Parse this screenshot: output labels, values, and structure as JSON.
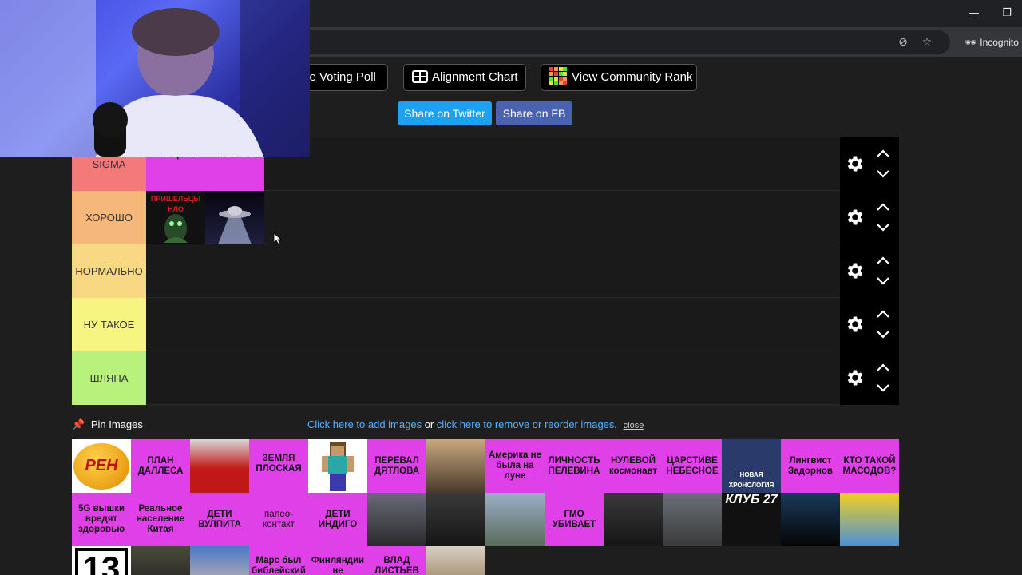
{
  "browser": {
    "minimize_icon": "minimize-icon",
    "restore_icon": "restore-icon",
    "incognito_label": "Incognito"
  },
  "toolbar": {
    "voting_poll": "ve Voting Poll",
    "alignment_chart": "Alignment Chart",
    "community_rank": "View Community Rank",
    "share_twitter": "Share on Twitter",
    "share_fb": "Share on FB"
  },
  "colors": {
    "tier_sigma": "#f47a7a",
    "tier_good": "#f6b87a",
    "tier_normal": "#f8d882",
    "tier_meh": "#f6f582",
    "tier_hat": "#b8f27c",
    "pink_tile": "#e040e8",
    "twitter": "#1da1f2",
    "fb": "#4a63b0"
  },
  "tiers": [
    {
      "label": "SIGMA",
      "items": [
        "ДВОИНИКИ ЕЛЬЦИНА",
        "ДВОИНИКИ ПУТИНА"
      ]
    },
    {
      "label": "ХОРОШО",
      "items": [
        "ПРИШЕЛЬЦЫ НЛО",
        ""
      ]
    },
    {
      "label": "НОРМАЛЬНО",
      "items": []
    },
    {
      "label": "НУ ТАКОЕ",
      "items": []
    },
    {
      "label": "ШЛЯПА",
      "items": []
    }
  ],
  "pin": {
    "title": "Pin Images",
    "add_link": "Click here to add images",
    "or": " or ",
    "remove_link": "click here to remove or reorder images",
    "dot": ".",
    "close": "close"
  },
  "pool": {
    "r1": [
      "РЕН",
      "ПЛАН ДАЛЛЕСА",
      "",
      "ЗЕМЛЯ ПЛОСКАЯ",
      "",
      "ПЕРЕВАЛ ДЯТЛОВА",
      "",
      "Америка не была на луне",
      "ЛИЧНОСТЬ ПЕЛЕВИНА",
      "НУЛЕВОЙ космонавт",
      "ЦАРСТИВЕ НЕБЕСНОЕ",
      "НОВАЯ ХРОНОЛОГИЯ",
      "Лингвист Задорнов",
      "КТО ТАКОЙ МАСОДОВ?"
    ],
    "r2": [
      "5G вышки вредят здоровью",
      "Реальное население Китая",
      "ДЕТИ ВУЛПИТА",
      "палео-контакт",
      "ДЕТИ ИНДИГО",
      "",
      "",
      "",
      "ГМО УБИВАЕТ",
      "",
      "",
      "КЛУБ 27",
      "",
      ""
    ],
    "r3": [
      "13",
      "",
      "",
      "Марс был библейский",
      "Финляндии не",
      "ВЛАД ЛИСТЬЕВ",
      ""
    ]
  }
}
